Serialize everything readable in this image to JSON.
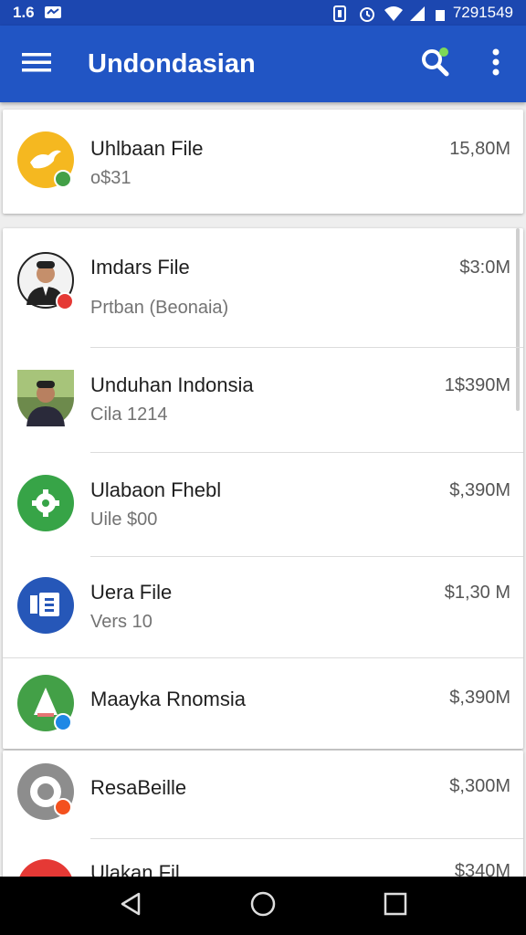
{
  "status_bar": {
    "left_text": "1.6",
    "right_text": "7291549",
    "icons": [
      "message-icon",
      "sim-icon",
      "alarm-icon",
      "wifi-icon",
      "signal-icon",
      "battery-icon"
    ]
  },
  "app_bar": {
    "title": "Undondasian",
    "icons": [
      "menu-icon",
      "search-icon",
      "more-vert-icon"
    ],
    "accent_color": "#2155c4"
  },
  "items": [
    {
      "title": "Uhlbaan File",
      "subtitle": "o$31",
      "size": "15,80M",
      "icon": "bird-app-icon",
      "color": "#f5b820",
      "badge_color": "#43a047"
    },
    {
      "title": "Imdars File",
      "subtitle": "Prtban (Beonaia)",
      "size": "$3:0M",
      "icon": "person-photo",
      "color": "#f2f2f2",
      "badge_color": "#e53935"
    },
    {
      "title": "Unduhan Indonsia",
      "subtitle": "Cila 1214",
      "size": "1$390M",
      "icon": "person-photo",
      "color": "#6d8a4c",
      "badge_color": ""
    },
    {
      "title": "Ulabaon Fhebl",
      "subtitle": "Uile $00",
      "size": "$,390M",
      "icon": "gear-app-icon",
      "color": "#37a447",
      "badge_color": ""
    },
    {
      "title": "Uera File",
      "subtitle": "Vers 10",
      "size": "$1,30 M",
      "icon": "document-app-icon",
      "color": "#2657b8",
      "badge_color": ""
    },
    {
      "title": "Maayka Rnomsia",
      "subtitle": "",
      "size": "$,390M",
      "icon": "triangle-app-icon",
      "color": "#43a047",
      "badge_color": "#1e88e5"
    },
    {
      "title": "ResaBeille",
      "subtitle": "",
      "size": "$,300M",
      "icon": "circle-app-icon",
      "color": "#8d8d8d",
      "badge_color": "#f4511e"
    },
    {
      "title": "Ulakan Fil",
      "subtitle": "",
      "size": "$340M",
      "icon": "app-icon",
      "color": "#e53935",
      "badge_color": ""
    }
  ],
  "nav_bar": {
    "icons": [
      "back-icon",
      "home-icon",
      "recents-icon"
    ]
  }
}
